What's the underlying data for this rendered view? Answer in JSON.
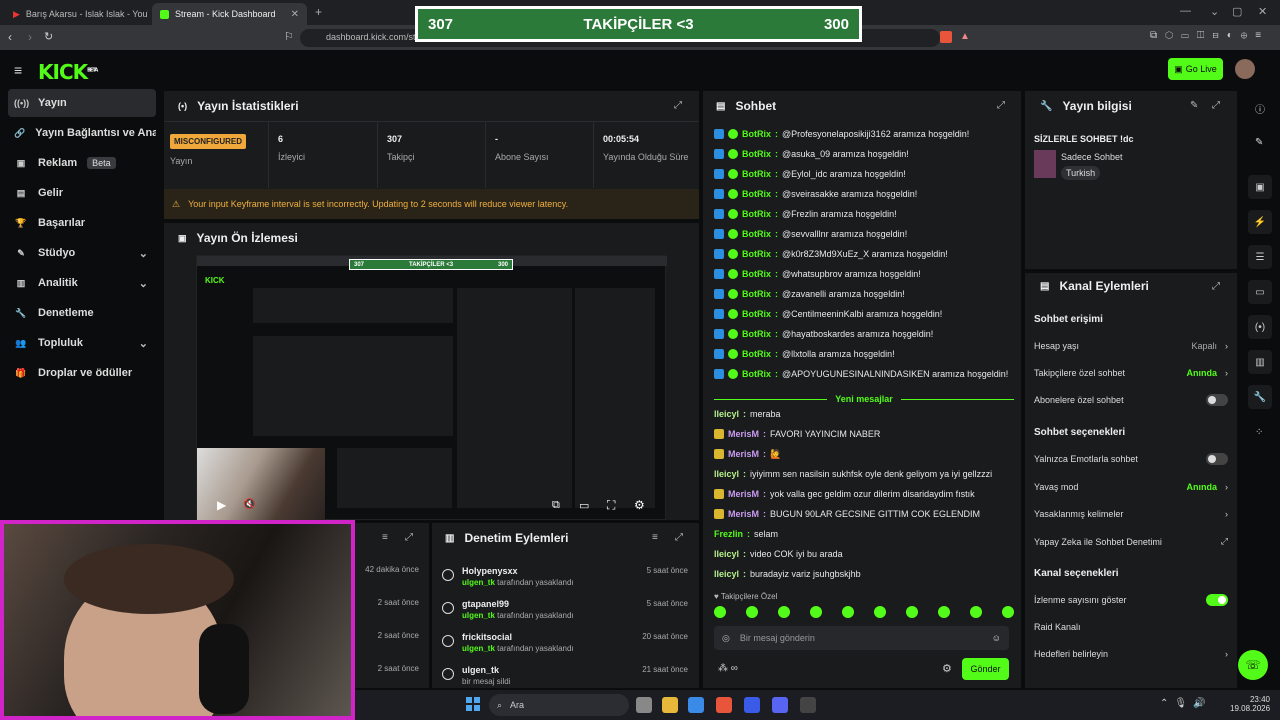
{
  "browser": {
    "tabs": [
      {
        "label": "Barış Akarsu - Islak Islak - YouTube"
      },
      {
        "label": "Stream - Kick Dashboard"
      }
    ],
    "url": "dashboard.kick.com/str"
  },
  "overlay": {
    "left": "307",
    "center": "TAKİPÇİLER <3",
    "right": "300"
  },
  "header": {
    "logo": "KICK",
    "logo_sup": "BETA",
    "go_live": "Go Live"
  },
  "sidebar": {
    "items": [
      {
        "label": "Yayın",
        "icon": "broadcast-icon",
        "selected": true
      },
      {
        "label": "Yayın Bağlantısı ve Anahtarı",
        "icon": "link-icon"
      },
      {
        "label": "Reklam",
        "icon": "ad-icon",
        "badge": "Beta"
      },
      {
        "label": "Gelir",
        "icon": "wallet-icon"
      },
      {
        "label": "Başarılar",
        "icon": "trophy-icon"
      },
      {
        "label": "Stüdyo",
        "icon": "studio-icon",
        "chevron": true
      },
      {
        "label": "Analitik",
        "icon": "chart-icon",
        "chevron": true
      },
      {
        "label": "Denetleme",
        "icon": "wrench-icon"
      },
      {
        "label": "Topluluk",
        "icon": "users-icon",
        "chevron": true
      },
      {
        "label": "Droplar ve ödüller",
        "icon": "gift-icon"
      }
    ]
  },
  "stats": {
    "title": "Yayın İstatistikleri",
    "status_badge": "MISCONFIGURED",
    "items": [
      {
        "value": "",
        "label": "Yayın"
      },
      {
        "value": "6",
        "label": "İzleyici"
      },
      {
        "value": "307",
        "label": "Takipçi"
      },
      {
        "value": "-",
        "label": "Abone Sayısı"
      },
      {
        "value": "00:05:54",
        "label": "Yayında Olduğu Süre"
      }
    ],
    "warning": "Your input Keyframe interval is set incorrectly. Updating to 2 seconds will reduce viewer latency."
  },
  "preview": {
    "title": "Yayın Ön İzlemesi",
    "mini_overlay": {
      "left": "307",
      "center": "TAKİPÇİLER <3",
      "right": "300"
    }
  },
  "left_times": [
    "42 dakika önce",
    "2 saat önce",
    "2 saat önce",
    "2 saat önce"
  ],
  "moderation": {
    "title": "Denetim Eylemleri",
    "rows": [
      {
        "name": "Holypenysxx",
        "by": "ulgen_tk",
        "action": "tarafından yasaklandı",
        "time": "5 saat önce"
      },
      {
        "name": "gtapanel99",
        "by": "ulgen_tk",
        "action": "tarafından yasaklandı",
        "time": "5 saat önce"
      },
      {
        "name": "frickitsocial",
        "by": "ulgen_tk",
        "action": "tarafından yasaklandı",
        "time": "20 saat önce"
      },
      {
        "name": "ulgen_tk",
        "by": "",
        "action": "bir mesaj sildi",
        "time": "21 saat önce"
      }
    ]
  },
  "chat": {
    "title": "Sohbet",
    "bot_messages": [
      {
        "user": "BotRix",
        "text": "@Profesyonelaposikiji3162 aramıza hoşgeldin!"
      },
      {
        "user": "BotRix",
        "text": "@asuka_09 aramıza hoşgeldin!"
      },
      {
        "user": "BotRix",
        "text": "@Eylol_idc aramıza hoşgeldin!"
      },
      {
        "user": "BotRix",
        "text": "@sveirasakke aramıza hoşgeldin!"
      },
      {
        "user": "BotRix",
        "text": "@Frezlin aramıza hoşgeldin!"
      },
      {
        "user": "BotRix",
        "text": "@sevvalllnr aramıza hoşgeldin!"
      },
      {
        "user": "BotRix",
        "text": "@k0r8Z3Md9XuEz_X aramıza hoşgeldin!"
      },
      {
        "user": "BotRix",
        "text": "@whatsupbrov aramıza hoşgeldin!"
      },
      {
        "user": "BotRix",
        "text": "@zavanelli aramıza hoşgeldin!"
      },
      {
        "user": "BotRix",
        "text": "@CentilmeeninKalbi aramıza hoşgeldin!"
      },
      {
        "user": "BotRix",
        "text": "@hayatboskardes aramıza hoşgeldin!"
      },
      {
        "user": "BotRix",
        "text": "@llxtolla aramıza hoşgeldin!"
      },
      {
        "user": "BotRix",
        "text": "@APOYUGUNESINALNINDASIKEN aramıza hoşgeldin!"
      }
    ],
    "new_messages_label": "Yeni mesajlar",
    "messages": [
      {
        "user": "lleicyl",
        "badge": false,
        "color": "#b7f08a",
        "text": "meraba"
      },
      {
        "user": "MerisM",
        "badge": true,
        "color": "#c99cf0",
        "text": "FAVORI YAYINCIM NABER"
      },
      {
        "user": "MerisM",
        "badge": true,
        "color": "#c99cf0",
        "text": "🙋"
      },
      {
        "user": "lleicyl",
        "badge": false,
        "color": "#b7f08a",
        "text": "iyiyimm sen nasilsin sukhfsk oyle denk geliyom ya iyi gellzzzi"
      },
      {
        "user": "MerisM",
        "badge": true,
        "color": "#c99cf0",
        "text": "yok valla gec geldim ozur dilerim disaridaydim fıstık"
      },
      {
        "user": "MerisM",
        "badge": true,
        "color": "#c99cf0",
        "text": "BUGUN 90LAR GECSINE GITTIM COK EGLENDIM"
      },
      {
        "user": "Frezlin",
        "badge": false,
        "color": "#53fc18",
        "text": "selam"
      },
      {
        "user": "lleicyl",
        "badge": false,
        "color": "#b7f08a",
        "text": "video COK iyi bu arada"
      },
      {
        "user": "lleicyl",
        "badge": false,
        "color": "#b7f08a",
        "text": "buradayiz variz jsuhgbskjhb"
      }
    ],
    "followers_only_label": "Takipçilere Özel",
    "input_placeholder": "Bir mesaj gönderin",
    "send_label": "Gönder"
  },
  "info": {
    "title": "Yayın bilgisi",
    "stream_title": "SİZLERLE SOHBET !dc",
    "category": "Sadece Sohbet",
    "tag": "Turkish"
  },
  "channel": {
    "title": "Kanal Eylemleri",
    "chat_access": "Sohbet erişimi",
    "rows1": [
      {
        "label": "Hesap yaşı",
        "value": "Kapalı",
        "type": "arrow",
        "muted": true
      },
      {
        "label": "Takipçilere özel sohbet",
        "value": "Anında",
        "type": "arrow"
      },
      {
        "label": "Abonelere özel sohbet",
        "type": "toggle",
        "on": false
      }
    ],
    "chat_options": "Sohbet seçenekleri",
    "rows2": [
      {
        "label": "Yalnızca Emotlarla sohbet",
        "type": "toggle",
        "on": false
      },
      {
        "label": "Yavaş mod",
        "value": "Anında",
        "type": "arrow"
      },
      {
        "label": "Yasaklanmış kelimeler",
        "type": "arrow"
      },
      {
        "label": "Yapay Zeka ile Sohbet Denetimi",
        "type": "ext"
      }
    ],
    "channel_options": "Kanal seçenekleri",
    "rows3": [
      {
        "label": "İzlenme sayısını göster",
        "type": "toggle",
        "on": true
      },
      {
        "label": "Raid Kanalı",
        "type": "none"
      },
      {
        "label": "Hedefleri belirleyin",
        "type": "arrow"
      }
    ]
  },
  "taskbar": {
    "search": "Ara",
    "time": "23:40",
    "date": "19.08.2026"
  },
  "colors": {
    "accent": "#53fc18",
    "bg": "#0b0c0d",
    "panel": "#191b1d",
    "cam_border": "#d023c8",
    "overlay_green": "#2b7a3a"
  }
}
